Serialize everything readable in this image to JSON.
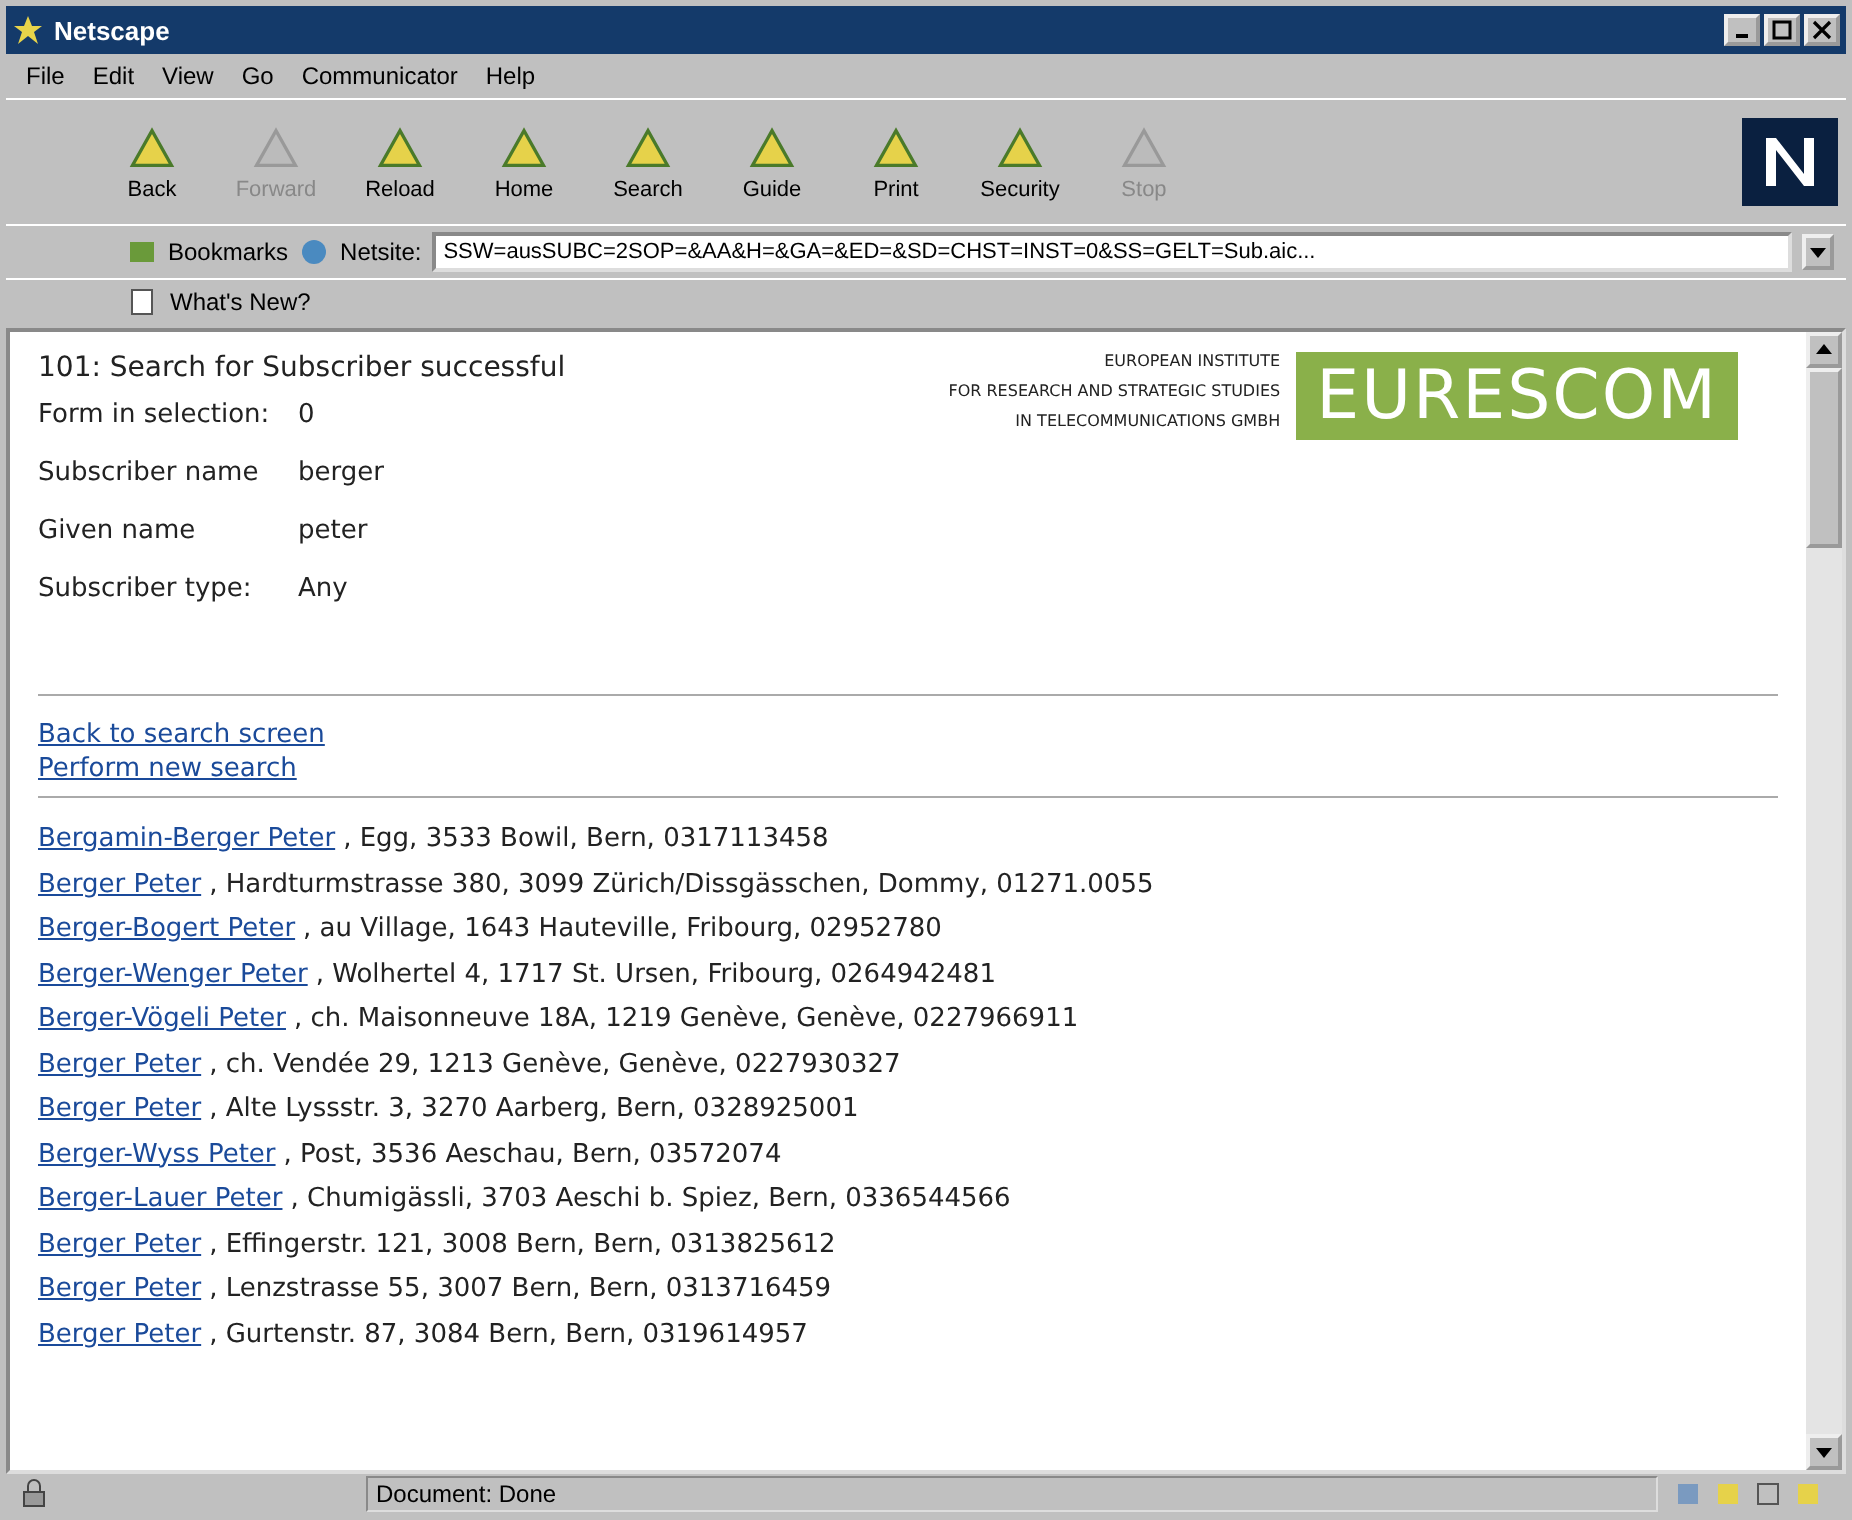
{
  "window": {
    "title": "Netscape"
  },
  "menu": [
    "File",
    "Edit",
    "View",
    "Go",
    "Communicator",
    "Help"
  ],
  "toolbar": [
    {
      "label": "Back",
      "disabled": false
    },
    {
      "label": "Forward",
      "disabled": true
    },
    {
      "label": "Reload",
      "disabled": false
    },
    {
      "label": "Home",
      "disabled": false
    },
    {
      "label": "Search",
      "disabled": false
    },
    {
      "label": "Guide",
      "disabled": false
    },
    {
      "label": "Print",
      "disabled": false
    },
    {
      "label": "Security",
      "disabled": false
    },
    {
      "label": "Stop",
      "disabled": true
    }
  ],
  "location": {
    "bookmarks": "Bookmarks",
    "label": "Netsite:",
    "value": "SSW=ausSUBC=2SOP=&AA&H=&GA=&ED=&SD=CHST=INST=0&SS=GELT=Sub.aic..."
  },
  "personal_toolbar": [
    "What's New?"
  ],
  "page": {
    "heading": "101: Search for Subscriber successful",
    "fields": [
      {
        "label": "Form in selection:",
        "value": "0"
      },
      {
        "label": "Subscriber name",
        "value": "berger"
      },
      {
        "label": "Given name",
        "value": "peter"
      },
      {
        "label": "Subscriber type:",
        "value": "Any"
      }
    ],
    "logo": {
      "lines": [
        "EUROPEAN INSTITUTE",
        "FOR RESEARCH AND STRATEGIC STUDIES",
        "IN TELECOMMUNICATIONS GMBH"
      ],
      "mark": "EURESCOM"
    },
    "links": [
      "Back to search screen",
      "Perform new search"
    ],
    "results": [
      {
        "name": "Bergamin-Berger Peter",
        "detail": ", Egg, 3533 Bowil, Bern, 0317113458"
      },
      {
        "name": "Berger Peter",
        "detail": ", Hardturmstrasse 380, 3099 Zürich/Dissgässchen, Dommy, 01271.0055"
      },
      {
        "name": "Berger-Bogert Peter",
        "detail": ", au Village, 1643 Hauteville, Fribourg, 02952780"
      },
      {
        "name": "Berger-Wenger Peter",
        "detail": ", Wolhertel 4, 1717 St. Ursen, Fribourg, 0264942481"
      },
      {
        "name": "Berger-Vögeli Peter",
        "detail": ", ch. Maisonneuve 18A, 1219 Genève, Genève, 0227966911"
      },
      {
        "name": "Berger Peter",
        "detail": ", ch. Vendée 29, 1213 Genève, Genève, 0227930327"
      },
      {
        "name": "Berger Peter",
        "detail": ", Alte Lyssstr. 3, 3270 Aarberg, Bern, 0328925001"
      },
      {
        "name": "Berger-Wyss Peter",
        "detail": ", Post, 3536 Aeschau, Bern, 03572074"
      },
      {
        "name": "Berger-Lauer Peter",
        "detail": ", Chumigässli, 3703 Aeschi b. Spiez, Bern, 0336544566"
      },
      {
        "name": "Berger Peter",
        "detail": ", Effingerstr. 121, 3008 Bern, Bern, 0313825612"
      },
      {
        "name": "Berger Peter",
        "detail": ", Lenzstrasse 55, 3007 Bern, Bern, 0313716459"
      },
      {
        "name": "Berger Peter",
        "detail": ", Gurtenstr. 87, 3084 Bern, Bern, 0319614957"
      }
    ]
  },
  "status_bar": {
    "text": "Document: Done"
  }
}
